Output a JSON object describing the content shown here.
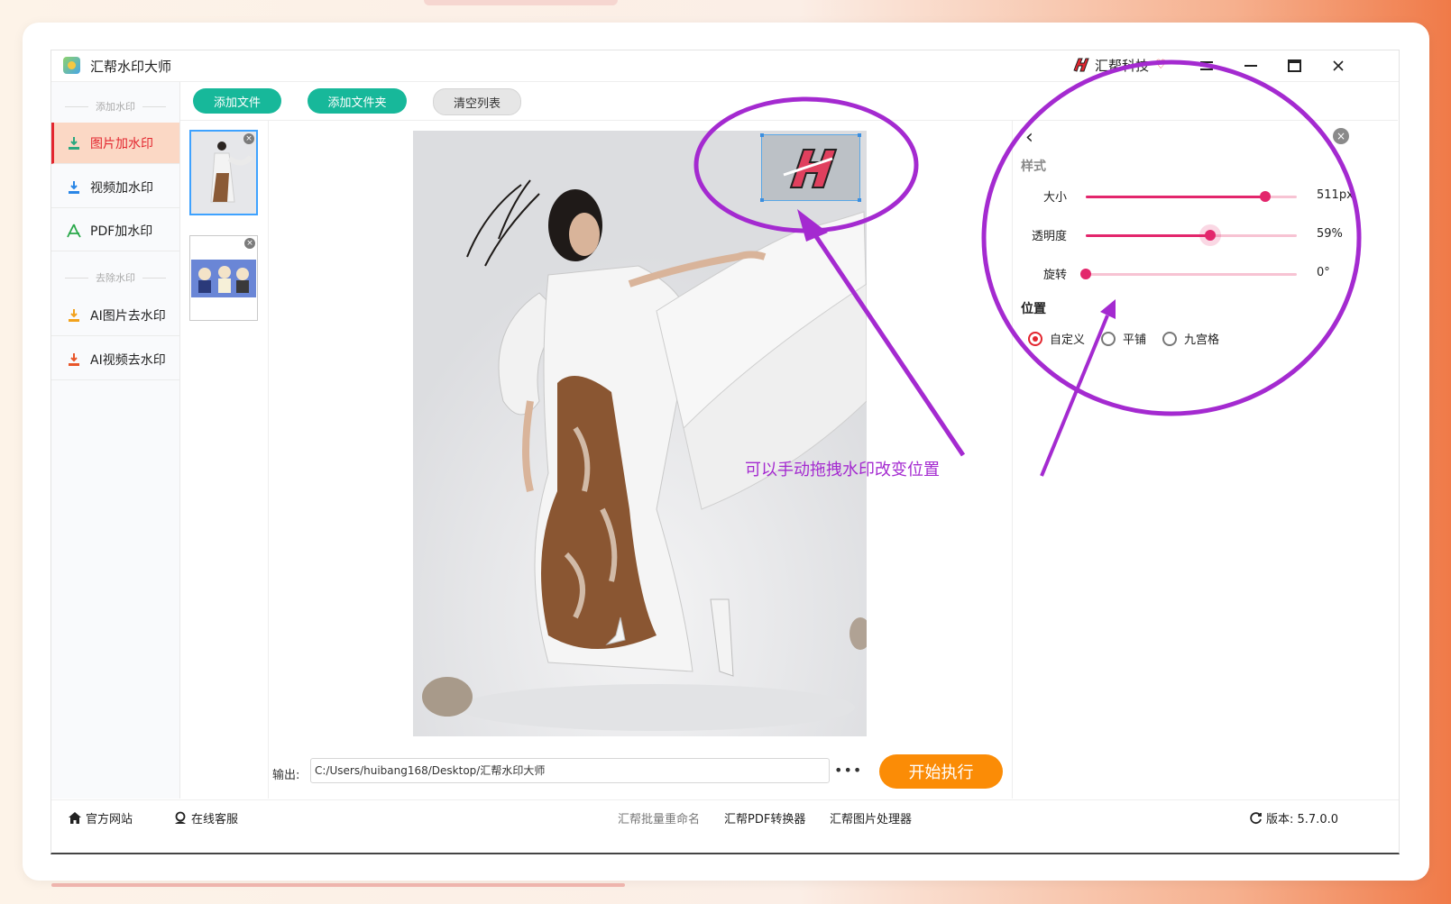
{
  "window": {
    "title": "汇帮水印大师",
    "brand": "汇帮科技",
    "controls": [
      "menu-icon",
      "minimize-icon",
      "maximize-icon",
      "close-icon"
    ]
  },
  "sidebar": {
    "sections": [
      {
        "label": "添加水印",
        "items": [
          {
            "label": "图片加水印",
            "icon": "image-watermark-icon",
            "active": true
          },
          {
            "label": "视频加水印",
            "icon": "video-watermark-icon",
            "active": false
          },
          {
            "label": "PDF加水印",
            "icon": "pdf-icon",
            "active": false
          }
        ]
      },
      {
        "label": "去除水印",
        "items": [
          {
            "label": "AI图片去水印",
            "icon": "ai-image-remove-icon",
            "active": false
          },
          {
            "label": "AI视频去水印",
            "icon": "ai-video-remove-icon",
            "active": false
          }
        ]
      }
    ]
  },
  "toolbar": {
    "add_file": "添加文件",
    "add_folder": "添加文件夹",
    "clear_list": "清空列表"
  },
  "output": {
    "label": "输出:",
    "path": "C:/Users/huibang168/Desktop/汇帮水印大师",
    "more": "•••",
    "start": "开始执行"
  },
  "settings": {
    "style_heading": "样式",
    "sliders": [
      {
        "label": "大小",
        "value_text": "511px",
        "fraction": 0.85
      },
      {
        "label": "透明度",
        "value_text": "59%",
        "fraction": 0.59
      },
      {
        "label": "旋转",
        "value_text": "0°",
        "fraction": 0.0
      }
    ],
    "position_heading": "位置",
    "position_options": [
      {
        "label": "自定义",
        "checked": true
      },
      {
        "label": "平铺",
        "checked": false
      },
      {
        "label": "九宫格",
        "checked": false
      }
    ]
  },
  "footer": {
    "website": "官方网站",
    "support": "在线客服",
    "rename": "汇帮批量重命名",
    "pdf": "汇帮PDF转换器",
    "image": "汇帮图片处理器",
    "version": "版本: 5.7.0.0"
  },
  "annotation": {
    "text": "可以手动拖拽水印改变位置"
  },
  "colors": {
    "accent_red": "#e3262f",
    "accent_green": "#17b89a",
    "start_orange": "#fb8c06",
    "slider_pink": "#e3266c",
    "annotation_purple": "#a42ad0"
  }
}
